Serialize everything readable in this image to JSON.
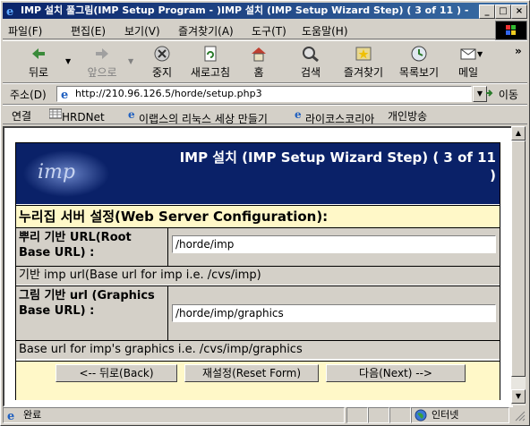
{
  "window": {
    "title": "IMP 설치 풀그림(IMP Setup Program - )IMP 설치 (IMP Setup Wizard Step) ( 3 of 11 ) - ...",
    "controls": [
      "_",
      "□",
      "×"
    ]
  },
  "menu": {
    "items": [
      "파일(F)",
      "편집(E)",
      "보기(V)",
      "즐겨찾기(A)",
      "도구(T)",
      "도움말(H)"
    ]
  },
  "toolbar": {
    "back": "뒤로",
    "forward": "앞으로",
    "stop": "중지",
    "refresh": "새로고침",
    "home": "홈",
    "search": "검색",
    "favorites": "즐겨찾기",
    "history": "목록보기",
    "mail": "메일",
    "more": "»"
  },
  "address": {
    "label": "주소(D)",
    "url": "http://210.96.126.5/horde/setup.php3",
    "go": "이동"
  },
  "links": {
    "label": "연결",
    "items": [
      "HRDNet",
      "이랩스의 리눅스 세상 만들기",
      "라이코스코리아",
      "개인방송"
    ]
  },
  "page": {
    "logo_text": "imp",
    "heading": "IMP 설치 (IMP Setup Wizard Step) ( 3 of 11 )",
    "section": "누리집 서버 설정(Web Server Configuration):",
    "fields": [
      {
        "label": "뿌리 기반 URL(Root Base URL) :",
        "value": "/horde/imp",
        "description": "기반 imp url(Base url for imp i.e. /cvs/imp)"
      },
      {
        "label": "그림 기반 url (Graphics Base URL) :",
        "value": "/horde/imp/graphics",
        "description": "Base url for imp's graphics i.e. /cvs/imp/graphics"
      }
    ],
    "buttons": {
      "back": "<-- 뒤로(Back)",
      "reset": "재설정(Reset Form)",
      "next": "다음(Next) -->"
    }
  },
  "status": {
    "text": "완료",
    "zone": "인터넷"
  },
  "colors": {
    "header_bg": "#0a2168",
    "section_bg": "#fff8c8",
    "chrome": "#d4d0c8"
  }
}
